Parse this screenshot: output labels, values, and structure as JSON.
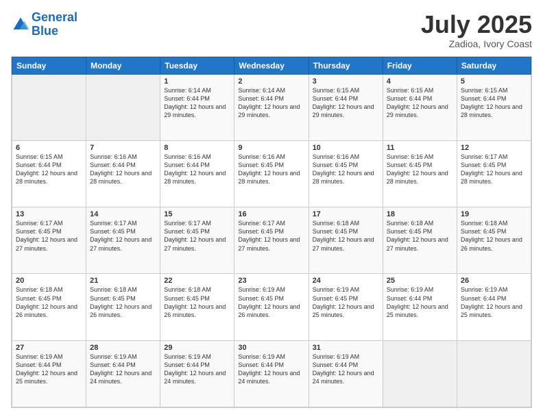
{
  "header": {
    "logo_line1": "General",
    "logo_line2": "Blue",
    "month": "July 2025",
    "location": "Zadioa, Ivory Coast"
  },
  "days_of_week": [
    "Sunday",
    "Monday",
    "Tuesday",
    "Wednesday",
    "Thursday",
    "Friday",
    "Saturday"
  ],
  "weeks": [
    [
      {
        "day": "",
        "info": ""
      },
      {
        "day": "",
        "info": ""
      },
      {
        "day": "1",
        "sunrise": "6:14 AM",
        "sunset": "6:44 PM",
        "daylight": "12 hours and 29 minutes."
      },
      {
        "day": "2",
        "sunrise": "6:14 AM",
        "sunset": "6:44 PM",
        "daylight": "12 hours and 29 minutes."
      },
      {
        "day": "3",
        "sunrise": "6:15 AM",
        "sunset": "6:44 PM",
        "daylight": "12 hours and 29 minutes."
      },
      {
        "day": "4",
        "sunrise": "6:15 AM",
        "sunset": "6:44 PM",
        "daylight": "12 hours and 29 minutes."
      },
      {
        "day": "5",
        "sunrise": "6:15 AM",
        "sunset": "6:44 PM",
        "daylight": "12 hours and 28 minutes."
      }
    ],
    [
      {
        "day": "6",
        "sunrise": "6:15 AM",
        "sunset": "6:44 PM",
        "daylight": "12 hours and 28 minutes."
      },
      {
        "day": "7",
        "sunrise": "6:16 AM",
        "sunset": "6:44 PM",
        "daylight": "12 hours and 28 minutes."
      },
      {
        "day": "8",
        "sunrise": "6:16 AM",
        "sunset": "6:44 PM",
        "daylight": "12 hours and 28 minutes."
      },
      {
        "day": "9",
        "sunrise": "6:16 AM",
        "sunset": "6:45 PM",
        "daylight": "12 hours and 28 minutes."
      },
      {
        "day": "10",
        "sunrise": "6:16 AM",
        "sunset": "6:45 PM",
        "daylight": "12 hours and 28 minutes."
      },
      {
        "day": "11",
        "sunrise": "6:16 AM",
        "sunset": "6:45 PM",
        "daylight": "12 hours and 28 minutes."
      },
      {
        "day": "12",
        "sunrise": "6:17 AM",
        "sunset": "6:45 PM",
        "daylight": "12 hours and 28 minutes."
      }
    ],
    [
      {
        "day": "13",
        "sunrise": "6:17 AM",
        "sunset": "6:45 PM",
        "daylight": "12 hours and 27 minutes."
      },
      {
        "day": "14",
        "sunrise": "6:17 AM",
        "sunset": "6:45 PM",
        "daylight": "12 hours and 27 minutes."
      },
      {
        "day": "15",
        "sunrise": "6:17 AM",
        "sunset": "6:45 PM",
        "daylight": "12 hours and 27 minutes."
      },
      {
        "day": "16",
        "sunrise": "6:17 AM",
        "sunset": "6:45 PM",
        "daylight": "12 hours and 27 minutes."
      },
      {
        "day": "17",
        "sunrise": "6:18 AM",
        "sunset": "6:45 PM",
        "daylight": "12 hours and 27 minutes."
      },
      {
        "day": "18",
        "sunrise": "6:18 AM",
        "sunset": "6:45 PM",
        "daylight": "12 hours and 27 minutes."
      },
      {
        "day": "19",
        "sunrise": "6:18 AM",
        "sunset": "6:45 PM",
        "daylight": "12 hours and 26 minutes."
      }
    ],
    [
      {
        "day": "20",
        "sunrise": "6:18 AM",
        "sunset": "6:45 PM",
        "daylight": "12 hours and 26 minutes."
      },
      {
        "day": "21",
        "sunrise": "6:18 AM",
        "sunset": "6:45 PM",
        "daylight": "12 hours and 26 minutes."
      },
      {
        "day": "22",
        "sunrise": "6:18 AM",
        "sunset": "6:45 PM",
        "daylight": "12 hours and 26 minutes."
      },
      {
        "day": "23",
        "sunrise": "6:19 AM",
        "sunset": "6:45 PM",
        "daylight": "12 hours and 26 minutes."
      },
      {
        "day": "24",
        "sunrise": "6:19 AM",
        "sunset": "6:45 PM",
        "daylight": "12 hours and 25 minutes."
      },
      {
        "day": "25",
        "sunrise": "6:19 AM",
        "sunset": "6:44 PM",
        "daylight": "12 hours and 25 minutes."
      },
      {
        "day": "26",
        "sunrise": "6:19 AM",
        "sunset": "6:44 PM",
        "daylight": "12 hours and 25 minutes."
      }
    ],
    [
      {
        "day": "27",
        "sunrise": "6:19 AM",
        "sunset": "6:44 PM",
        "daylight": "12 hours and 25 minutes."
      },
      {
        "day": "28",
        "sunrise": "6:19 AM",
        "sunset": "6:44 PM",
        "daylight": "12 hours and 24 minutes."
      },
      {
        "day": "29",
        "sunrise": "6:19 AM",
        "sunset": "6:44 PM",
        "daylight": "12 hours and 24 minutes."
      },
      {
        "day": "30",
        "sunrise": "6:19 AM",
        "sunset": "6:44 PM",
        "daylight": "12 hours and 24 minutes."
      },
      {
        "day": "31",
        "sunrise": "6:19 AM",
        "sunset": "6:44 PM",
        "daylight": "12 hours and 24 minutes."
      },
      {
        "day": "",
        "info": ""
      },
      {
        "day": "",
        "info": ""
      }
    ]
  ]
}
